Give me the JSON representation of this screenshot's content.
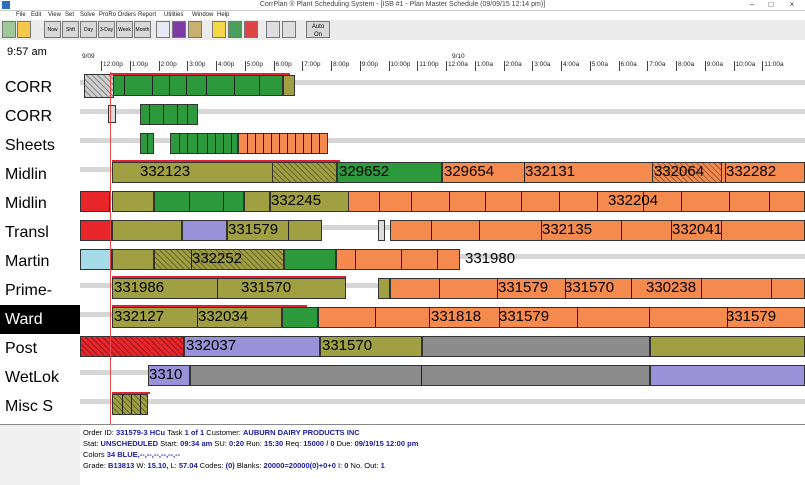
{
  "window": {
    "title": "CorrPlan ® Plant Scheduling System - [ISB #1 - Plan Master Schedule (09/09/15 12:14 pm)]",
    "minimize": "–",
    "maximize": "□",
    "close": "×"
  },
  "menu": [
    "File",
    "Edit",
    "View",
    "Set",
    "Solve",
    "ProRo Orders",
    "Report",
    "Utilities",
    "Window",
    "Help"
  ],
  "toolbar": {
    "buttons": [
      "Now",
      "Shft",
      "Day",
      "3-Day",
      "Week",
      "Month"
    ],
    "auto_label": "Auto",
    "auto_sub": "On"
  },
  "clock": "9:57 am",
  "timeline": {
    "dates": [
      "9/09",
      "9/10"
    ],
    "ticks": [
      "12:00p",
      "1:00p",
      "2:00p",
      "3:00p",
      "4:00p",
      "5:00p",
      "6:00p",
      "7:00p",
      "8:00p",
      "9:00p",
      "10:00p",
      "11:00p",
      "12:00a",
      "1:00a",
      "2:00a",
      "3:00a",
      "4:00a",
      "5:00a",
      "6:00a",
      "7:00a",
      "8:00a",
      "9:00a",
      "10:00a",
      "11:00a"
    ]
  },
  "rows": [
    "CORR",
    "CORR",
    "Sheets",
    "Midlin",
    "Midlin",
    "Transl",
    "Martin",
    "Prime-",
    "Ward",
    "Post",
    "WetLok",
    "Misc S"
  ],
  "selected_row": "Ward",
  "colors": {
    "olive": "#a0a042",
    "green": "#2c9a3c",
    "orange": "#f58a4e",
    "lavender": "#9a92d8",
    "gray": "#8c8c8c",
    "red": "#e8252a",
    "lightblue": "#a6dbe8"
  },
  "bars": {
    "midlin1": [
      "332123",
      "329652",
      "329654",
      "332131",
      "332064",
      "332282"
    ],
    "midlin2": [
      "332245",
      "332204"
    ],
    "transl": [
      "331579",
      "332135",
      "332041"
    ],
    "martin": [
      "332252",
      "331980"
    ],
    "prime": [
      "331986",
      "331570",
      "331579",
      "331570",
      "330238"
    ],
    "ward": [
      "332127",
      "332034",
      "331818",
      "331579",
      "331579"
    ],
    "post": [
      "332037",
      "331570"
    ],
    "wetlok": [
      "3310"
    ]
  },
  "details": {
    "line1": {
      "order_label": "Order ID:",
      "order": "331579-3 HCu",
      "task_label": "Task",
      "task": "1 of 1",
      "customer_label": "Customer:",
      "customer": "AUBURN DAIRY PRODUCTS INC"
    },
    "line2": {
      "stat_label": "Stat:",
      "stat": "UNSCHEDULED",
      "start_label": "Start:",
      "start": "09:34 am",
      "su_label": "SU:",
      "su": "0:20",
      "run_label": "Run:",
      "run": "15:30",
      "req_label": "Req:",
      "req": "15000 / 0",
      "due_label": "Due:",
      "due": "09/19/15 12:00 pm"
    },
    "line3": {
      "colors_label": "Colors",
      "colors": "34 BLUE,--,--,--,--,--,--"
    },
    "line4": {
      "grade_label": "Grade:",
      "grade": "B13813",
      "w_label": "W:",
      "w": "15.10,",
      "l_label": "L:",
      "l": "57.04",
      "codes_label": "Codes:",
      "codes": "(0)",
      "blanks_label": "Blanks:",
      "blanks": "20000=20000(0)+0+0",
      "i_label": "I:",
      "i": "0",
      "nout_label": "No. Out:",
      "nout": "1"
    }
  }
}
